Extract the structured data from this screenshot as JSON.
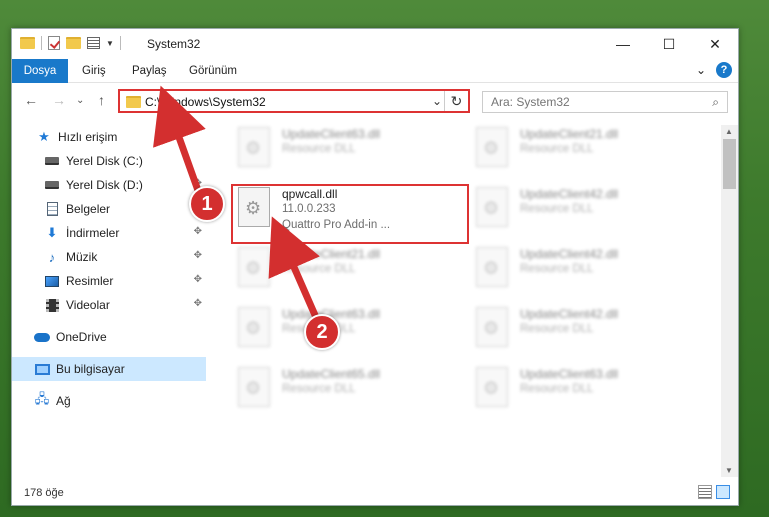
{
  "titlebar": {
    "title": "System32",
    "controls": {
      "minimize": "—",
      "maximize": "☐",
      "close": "✕"
    }
  },
  "ribbon": {
    "tabs": [
      {
        "label": "Dosya"
      },
      {
        "label": "Giriş"
      },
      {
        "label": "Paylaş"
      },
      {
        "label": "Görünüm"
      }
    ],
    "collapse": "⌄",
    "help": "?"
  },
  "nav": {
    "back": "←",
    "forward": "→",
    "recent": "⌄",
    "up": "↑",
    "path": "C:\\Windows\\System32",
    "path_chevron": "⌄",
    "refresh": "↻",
    "search_placeholder": "Ara: System32",
    "search_icon": "⌕"
  },
  "sidebar": {
    "items": [
      {
        "label": "Hızlı erişim",
        "icon": "star-icon"
      },
      {
        "label": "Yerel Disk (C:)",
        "icon": "drive-icon",
        "pin": "✥"
      },
      {
        "label": "Yerel Disk (D:)",
        "icon": "drive-icon",
        "pin": "✥"
      },
      {
        "label": "Belgeler",
        "icon": "document-icon",
        "pin": "✥"
      },
      {
        "label": "İndirmeler",
        "icon": "download-icon",
        "pin": "✥"
      },
      {
        "label": "Müzik",
        "icon": "music-icon",
        "pin": "✥"
      },
      {
        "label": "Resimler",
        "icon": "pictures-icon",
        "pin": "✥"
      },
      {
        "label": "Videolar",
        "icon": "video-icon",
        "pin": "✥"
      },
      {
        "label": "OneDrive",
        "icon": "cloud-icon"
      },
      {
        "label": "Bu bilgisayar",
        "icon": "computer-icon",
        "selected": true
      },
      {
        "label": "Ağ",
        "icon": "network-icon"
      }
    ]
  },
  "files": {
    "featured": {
      "name": "qpwcall.dll",
      "version": "11.0.0.233",
      "description": "Quattro Pro Add-in ..."
    },
    "left_column": [
      {
        "name": "UpdateClient63.dll",
        "desc": "Resource DLL"
      },
      {
        "name": "UpdateClient21.dll",
        "desc": "Resource DLL"
      },
      {
        "name": "UpdateClient63.dll",
        "desc": "Resource DLL"
      },
      {
        "name": "UpdateClient65.dll",
        "desc": "Resource DLL"
      }
    ],
    "right_column": [
      {
        "name": "UpdateClient21.dll",
        "desc": "Resource DLL"
      },
      {
        "name": "UpdateClient42.dll",
        "desc": "Resource DLL"
      },
      {
        "name": "UpdateClient42.dll",
        "desc": "Resource DLL"
      },
      {
        "name": "UpdateClient42.dll",
        "desc": "Resource DLL"
      },
      {
        "name": "UpdateClient63.dll",
        "desc": "Resource DLL"
      }
    ]
  },
  "status": {
    "count": "178 öğe"
  },
  "scroll": {
    "up": "▲",
    "down": "▼"
  },
  "annotations": {
    "step1": "1",
    "step2": "2"
  },
  "colors": {
    "accent": "#1979ca",
    "highlight": "#d33333",
    "selected": "#cce8ff"
  }
}
